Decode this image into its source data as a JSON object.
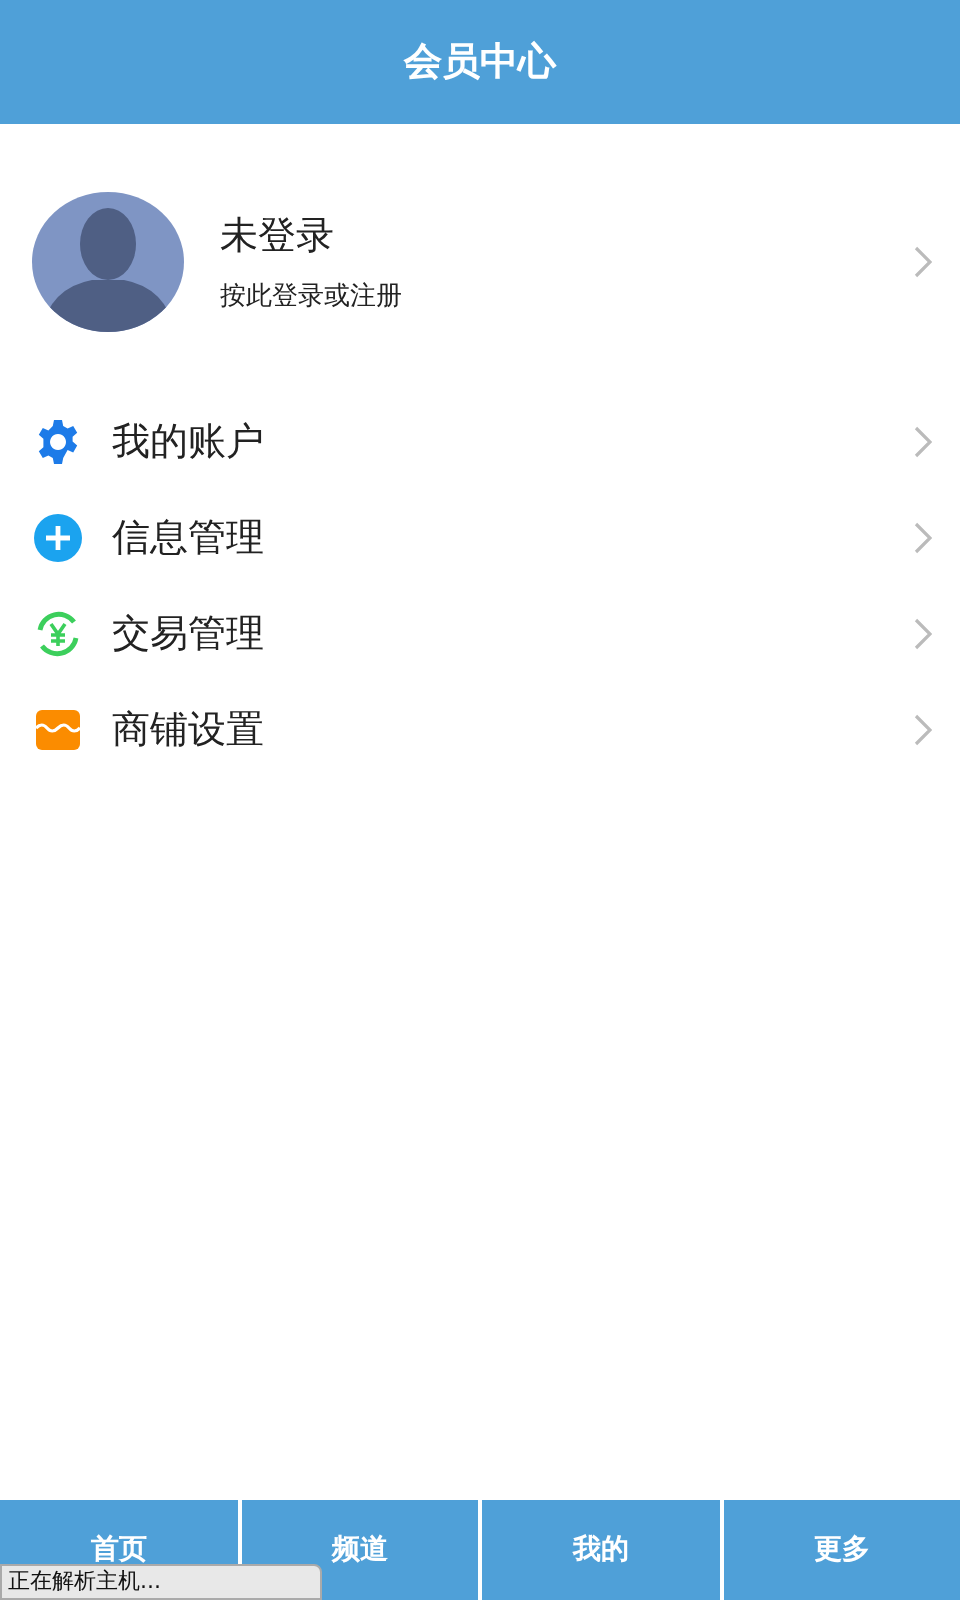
{
  "header": {
    "title": "会员中心"
  },
  "profile": {
    "name": "未登录",
    "hint": "按此登录或注册"
  },
  "menu": [
    {
      "kind": "gear",
      "label": "我的账户"
    },
    {
      "kind": "plus",
      "label": "信息管理"
    },
    {
      "kind": "yen",
      "label": "交易管理"
    },
    {
      "kind": "shop",
      "label": "商铺设置"
    }
  ],
  "tabbar": [
    "首页",
    "频道",
    "我的",
    "更多"
  ],
  "status_bar": {
    "text": "正在解析主机..."
  }
}
